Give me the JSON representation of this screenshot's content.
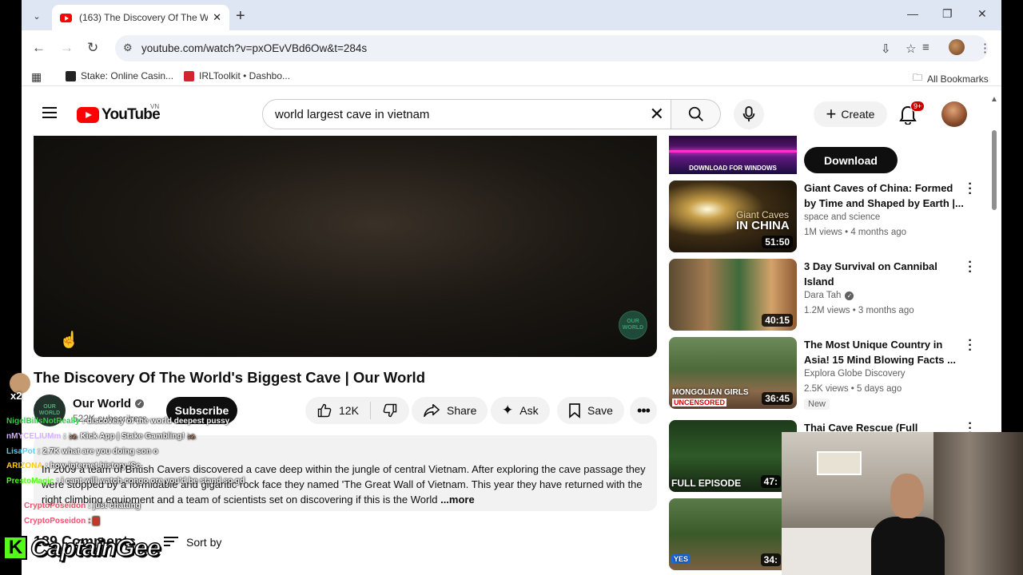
{
  "browser": {
    "tab_title": "(163) The Discovery Of The Wor",
    "url": "youtube.com/watch?v=pxOEvVBd6Ow&t=284s",
    "bookmarks": [
      {
        "label": "Stake: Online Casin..."
      },
      {
        "label": "IRLToolkit • Dashbo..."
      }
    ],
    "all_bookmarks_label": "All Bookmarks"
  },
  "youtube": {
    "logo_text": "YouTube",
    "country_code": "VN",
    "search_query": "world largest cave in vietnam",
    "create_label": "Create",
    "notification_count": "9+"
  },
  "video": {
    "watermark": "OUR WORLD",
    "title": "The Discovery Of The World's Biggest Cave | Our World",
    "channel": "Our World",
    "channel_avatar_text": "OUR WORLD",
    "subscribers": "522K subscribers",
    "subscribe_label": "Subscribe",
    "likes": "12K",
    "share_label": "Share",
    "ask_label": "Ask",
    "save_label": "Save",
    "description": "In 2009 a team of British Cavers discovered a cave deep within the jungle of central Vietnam. After exploring the cave passage they were stopped by a formidable and gigantic rock face they named 'The Great Wall of Vietnam. This year they have returned with the right climbing equipment and a team of scientists set on discovering if this is the World",
    "more_label": "...more",
    "comments_count_label": "189 Comments",
    "sort_label": "Sort by"
  },
  "ad": {
    "thumb_text": "DOWNLOAD FOR WINDOWS",
    "download_label": "Download"
  },
  "recommendations": [
    {
      "title": "Giant Caves of China: Formed by Time and Shaped by Earth |...",
      "channel": "space and science",
      "meta": "1M views • 4 months ago",
      "duration": "51:50",
      "thumb_text_1": "Giant Caves",
      "thumb_text_2": "IN CHINA",
      "verified": false
    },
    {
      "title": "3 Day Survival on Cannibal Island",
      "channel": "Dara Tah",
      "meta": "1.2M views • 3 months ago",
      "duration": "40:15",
      "verified": true
    },
    {
      "title": "The Most Unique Country in Asia! 15 Mind Blowing Facts ...",
      "channel": "Explora Globe Discovery",
      "meta": "2.5K views • 5 days ago",
      "badge": "New",
      "duration": "36:45",
      "thumb_text_1": "MONGOLIAN GIRLS",
      "thumb_text_2": "UNCENSORED",
      "verified": false
    },
    {
      "title": "Thai Cave Rescue (Full Episode)",
      "duration": "47:",
      "thumb_text_1": "FULL EPISODE"
    },
    {
      "duration": "34:",
      "thumb_text_1": "YES"
    }
  ],
  "chat": [
    {
      "user": "NigelBillsNotReally",
      "msg": ": discovery of the world deepest pussy",
      "color": "#2ecc40"
    },
    {
      "user": "nMYCELIUMm",
      "msg": ": 🦗 Kick App | Stake Gambling! 🦗",
      "color": "#d4b0ff"
    },
    {
      "user": "LisaPot",
      "msg": ": 2.7K what are you doing son o",
      "color": "#4fd1ff"
    },
    {
      "user": "ARIZONA",
      "msg": ": how internet history 'Sc",
      "color": "#ffcc00"
    },
    {
      "user": "PrestoMagic",
      "msg": ": i cant will watch congo ore you'd be stand so gd",
      "color": "#53fc18"
    },
    {
      "user": "CryptoPoseidon",
      "msg": ": just chatting",
      "color": "#ff4d6d"
    },
    {
      "user": "CryptoPoseidon",
      "msg": ": ▇",
      "color": "#ff4d6d"
    }
  ],
  "overlay": {
    "multiplier": "x2",
    "brand_name": "CaptainGee",
    "brand_letter": "K"
  }
}
